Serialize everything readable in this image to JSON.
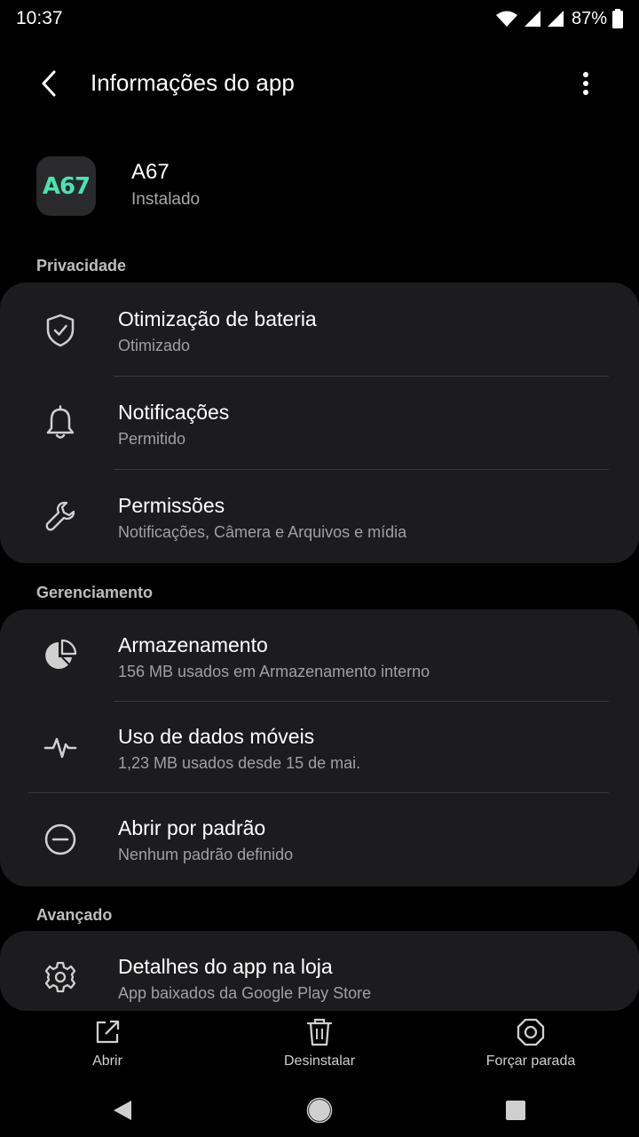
{
  "status_bar": {
    "time": "10:37",
    "battery": "87%",
    "icons": [
      "wifi-icon",
      "signal-icon",
      "signal-icon",
      "battery-icon"
    ]
  },
  "app_bar": {
    "title": "Informações do app",
    "icons": [
      "back-arrow-icon",
      "more-vert-icon"
    ]
  },
  "app": {
    "icon_text": "A67",
    "name": "A67",
    "status": "Instalado"
  },
  "sections": [
    {
      "label": "Privacidade",
      "items": [
        {
          "title": "Otimização de bateria",
          "subtitle": "Otimizado",
          "icon": "shield-check-icon"
        },
        {
          "title": "Notificações",
          "subtitle": "Permitido",
          "icon": "bell-icon"
        },
        {
          "title": "Permissões",
          "subtitle": "Notificações, Câmera e Arquivos e mídia",
          "icon": "wrench-icon"
        }
      ]
    },
    {
      "label": "Gerenciamento",
      "items": [
        {
          "title": "Armazenamento",
          "subtitle": "156 MB usados em Armazenamento interno",
          "icon": "pie-chart-icon"
        },
        {
          "title": "Uso de dados móveis",
          "subtitle": "1,23 MB usados desde 15 de mai.",
          "icon": "activity-icon"
        },
        {
          "title": "Abrir por padrão",
          "subtitle": "Nenhum padrão definido",
          "icon": "minus-circle-icon"
        }
      ]
    },
    {
      "label": "Avançado",
      "items": [
        {
          "title": "Detalhes do app na loja",
          "subtitle": "App baixados da Google Play Store",
          "icon": "gear-icon"
        }
      ]
    }
  ],
  "bottom_actions": [
    {
      "label": "Abrir",
      "icon": "open-external-icon"
    },
    {
      "label": "Desinstalar",
      "icon": "trash-icon"
    },
    {
      "label": "Forçar parada",
      "icon": "stop-octagon-icon"
    }
  ],
  "nav_bar": {
    "icons": [
      "nav-back-icon",
      "nav-home-icon",
      "nav-recents-icon"
    ]
  }
}
